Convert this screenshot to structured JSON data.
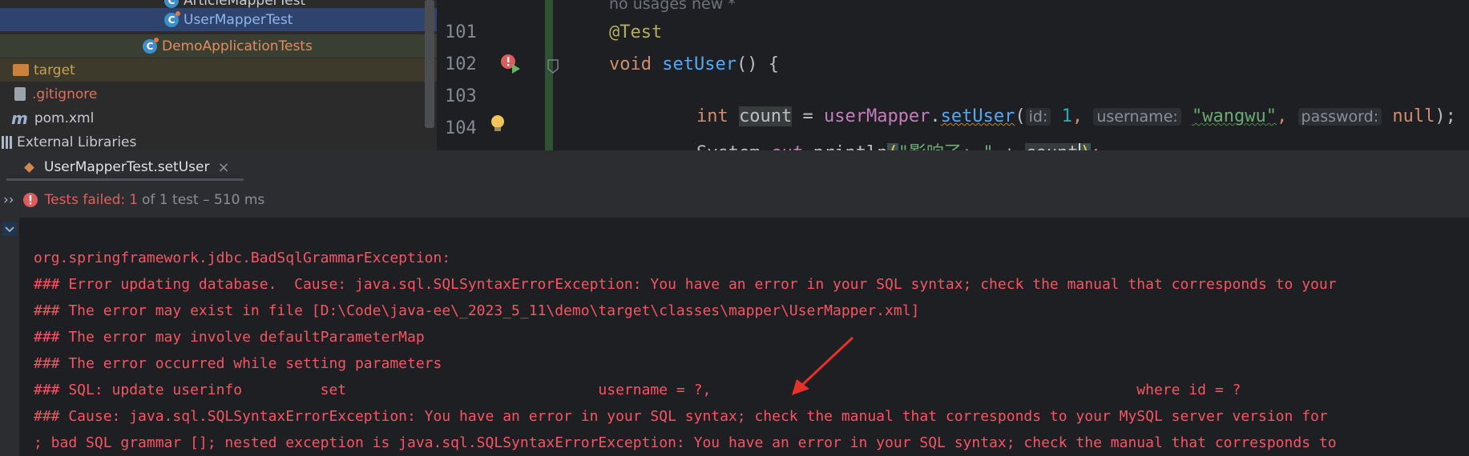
{
  "project_tree": {
    "items": [
      {
        "label": "ArticleMapperTest"
      },
      {
        "label": "UserMapperTest"
      },
      {
        "label": "DemoApplicationTests"
      },
      {
        "label": "target"
      },
      {
        "label": ".gitignore"
      },
      {
        "label": "pom.xml"
      },
      {
        "label": "External Libraries"
      }
    ],
    "class_icon_letter": "C",
    "maven_icon_letter": "m"
  },
  "editor": {
    "usages_hint": "no usages   new *",
    "line_numbers": [
      "101",
      "102",
      "103",
      "104"
    ],
    "line101": {
      "annotation": "@Test"
    },
    "line102": {
      "kw": "void",
      "method": "setUser",
      "rest": "() {"
    },
    "line103": {
      "kw": "int",
      "var": "count",
      "eq": " = ",
      "obj": "userMapper",
      "dot": ".",
      "method": "setUser",
      "open": "(",
      "hint_id": "id:",
      "val_id": "1",
      "comma1": ",",
      "hint_username": "username:",
      "val_username": "\"wangwu\"",
      "comma2": ",",
      "hint_password": "password:",
      "val_password": "null",
      "close": ");"
    },
    "line104": {
      "cls": "System",
      "dot1": ".",
      "field": "out",
      "dot2": ".",
      "method": "println",
      "open": "(",
      "str": "\"影响了: \"",
      "plus": " + ",
      "var": "count",
      "close": ")",
      "semi": ";"
    }
  },
  "run_panel": {
    "tab_label": "UserMapperTest.setUser",
    "tab_close": "×",
    "expand_glyph": "››",
    "status_failed": "Tests failed:",
    "status_count": "1",
    "status_rest": "of 1 test – 510 ms",
    "console_lines": [
      "org.springframework.jdbc.BadSqlGrammarException:",
      "### Error updating database.  Cause: java.sql.SQLSyntaxErrorException: You have an error in your SQL syntax; check the manual that corresponds to your",
      "### The error may exist in file [D:\\Code\\java-ee\\_2023_5_11\\demo\\target\\classes\\mapper\\UserMapper.xml]",
      "### The error may involve defaultParameterMap",
      "### The error occurred while setting parameters",
      "### SQL: update userinfo         set                             username = ?,                                                 where id = ?",
      "### Cause: java.sql.SQLSyntaxErrorException: You have an error in your SQL syntax; check the manual that corresponds to your MySQL server version for",
      "; bad SQL grammar []; nested exception is java.sql.SQLSyntaxErrorException: You have an error in your SQL syntax; check the manual that corresponds to"
    ]
  },
  "colors": {
    "error_red": "#f75464",
    "arrow_red": "#e8302a",
    "selection": "#2e436e"
  }
}
